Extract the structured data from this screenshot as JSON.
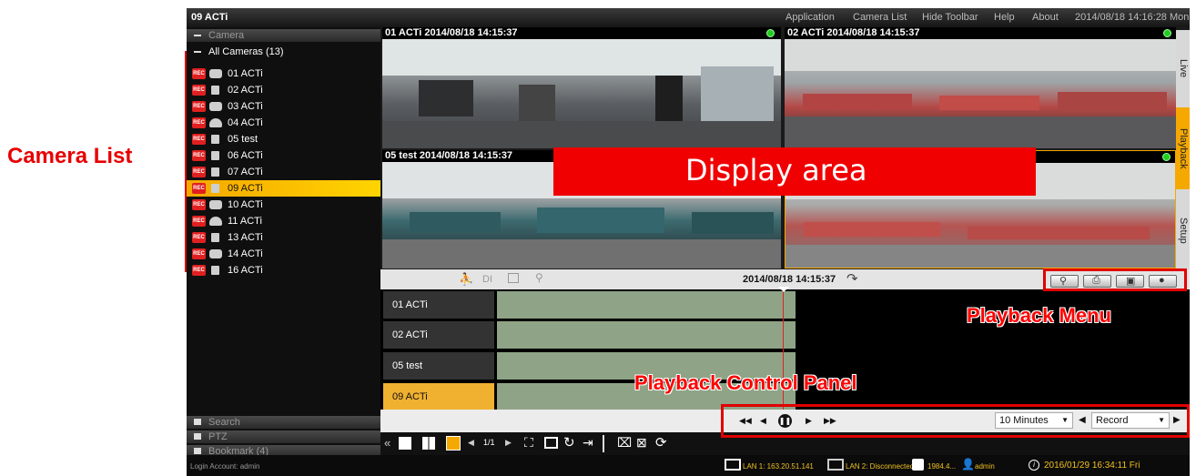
{
  "annotations": {
    "camera_list": "Camera List",
    "display_area": "Display area",
    "playback_menu": "Playback Menu",
    "playback_control_panel": "Playback Control Panel"
  },
  "app": {
    "title": "09 ACTi",
    "menu": [
      "Application",
      "Camera List",
      "Hide Toolbar",
      "Help",
      "About"
    ],
    "clock": "2014/08/18 14:16:28 Mon"
  },
  "sidebar": {
    "camera_header": "Camera",
    "all_cameras": "All Cameras (13)",
    "cameras": [
      {
        "name": "01  ACTi",
        "icon": "bullet-camera-icon"
      },
      {
        "name": "02  ACTi",
        "icon": "box-camera-icon"
      },
      {
        "name": "03  ACTi",
        "icon": "bullet-camera-icon"
      },
      {
        "name": "04  ACTi",
        "icon": "dome-camera-icon"
      },
      {
        "name": "05  test",
        "icon": "box-camera-icon"
      },
      {
        "name": "06  ACTi",
        "icon": "box-camera-icon"
      },
      {
        "name": "07  ACTi",
        "icon": "box-camera-icon"
      },
      {
        "name": "09  ACTi",
        "icon": "fisheye-camera-icon",
        "selected": true
      },
      {
        "name": "10  ACTi",
        "icon": "bullet-camera-icon"
      },
      {
        "name": "11  ACTi",
        "icon": "dome-camera-icon"
      },
      {
        "name": "13  ACTi",
        "icon": "box-camera-icon"
      },
      {
        "name": "14  ACTi",
        "icon": "bullet-camera-icon"
      },
      {
        "name": "16  ACTi",
        "icon": "fisheye-camera-icon"
      }
    ],
    "rec_badge": "REC",
    "search": "Search",
    "ptz": "PTZ",
    "bookmark": "Bookmark (4)",
    "login": "Login Account: admin"
  },
  "tiles": [
    {
      "title": "01 ACTi   2014/08/18 14:15:37"
    },
    {
      "title": "02 ACTi   2014/08/18 14:15:37"
    },
    {
      "title": "05 test   2014/08/18 14:15:37"
    },
    {
      "title": ""
    }
  ],
  "right_tabs": [
    "Live",
    "Playback",
    "Setup"
  ],
  "timeline": {
    "filters": [
      "DI"
    ],
    "timestamp": "2014/08/18 14:15:37",
    "rows": [
      "01 ACTi",
      "02 ACTi",
      "05 test",
      "09 ACTi"
    ],
    "interval": "10 Minutes",
    "mode": "Record"
  },
  "toolbar": {
    "page": "1/1"
  },
  "status": {
    "lan1": "LAN 1: 163.20.51.141",
    "lan2": "LAN 2: Disconnected",
    "storage": "1984.4...",
    "user": "admin",
    "datetime": "2016/01/29 16:34:11 Fri"
  }
}
